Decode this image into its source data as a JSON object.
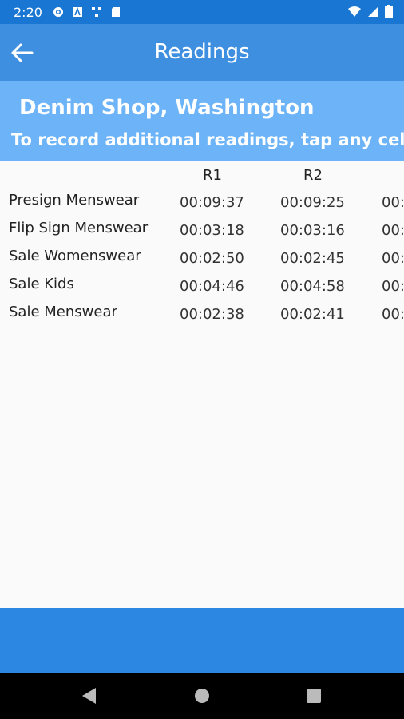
{
  "status": {
    "time": "2:20",
    "icons": [
      "settings-icon",
      "text-box-icon",
      "network-icon",
      "sd-card-icon",
      "wifi-icon",
      "signal-icon",
      "battery-icon"
    ]
  },
  "app_bar": {
    "title": "Readings",
    "back_icon": "arrow-left-icon"
  },
  "shop": {
    "name": "Denim Shop, Washington",
    "hint": "To record additional readings, tap any cell"
  },
  "table": {
    "columns": [
      "R1",
      "R2",
      ""
    ],
    "rows": [
      {
        "label": "Presign Menswear",
        "cells": [
          "00:09:37",
          "00:09:25",
          "00:"
        ]
      },
      {
        "label": "Flip Sign Menswear",
        "cells": [
          "00:03:18",
          "00:03:16",
          "00:"
        ]
      },
      {
        "label": "Sale Womenswear",
        "cells": [
          "00:02:50",
          "00:02:45",
          "00:"
        ]
      },
      {
        "label": "Sale Kids",
        "cells": [
          "00:04:46",
          "00:04:58",
          "00:"
        ]
      },
      {
        "label": "Sale Menswear",
        "cells": [
          "00:02:38",
          "00:02:41",
          "00:"
        ]
      }
    ]
  },
  "colors": {
    "status_bar": "#1976d2",
    "app_bar": "#3f8fe0",
    "header": "#6cb4f7",
    "bottom_bar": "#2b87e2"
  }
}
